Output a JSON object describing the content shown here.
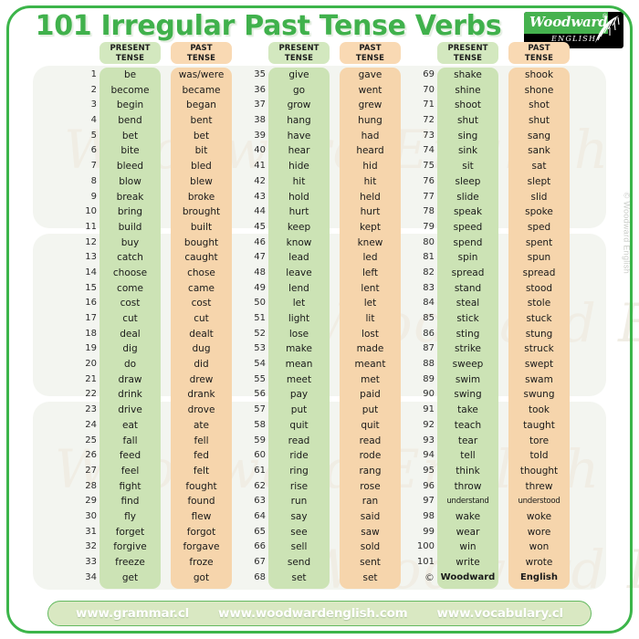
{
  "title": "101 Irregular Past Tense Verbs",
  "logo": {
    "brand": "Woodward",
    "registered": "®",
    "sub": "ENGLISH",
    "leaf_icon": "fern-leaf-icon"
  },
  "side_copyright": "© Woodward English",
  "watermark_text": "Woodward English",
  "colors": {
    "frame_green": "#3cb54a",
    "title_green": "#40b14c",
    "present_cell": "#cce3b5",
    "present_header": "#d3e8bf",
    "past_cell": "#f6d5ac",
    "past_header": "#f9d9b3",
    "urlbar_bg": "#d9e8c2",
    "urlbar_border": "#63b95f"
  },
  "headers": {
    "present_line1": "PRESENT",
    "present_line2": "TENSE",
    "past_line1": "PAST",
    "past_line2": "TENSE"
  },
  "footer_row": {
    "num": "©",
    "present": "Woodward",
    "past": "English"
  },
  "links": [
    "www.grammar.cl",
    "www.woodwardenglish.com",
    "www.vocabulary.cl"
  ],
  "columns": [
    {
      "rows": [
        {
          "n": "1",
          "present": "be",
          "past": "was/were"
        },
        {
          "n": "2",
          "present": "become",
          "past": "became"
        },
        {
          "n": "3",
          "present": "begin",
          "past": "began"
        },
        {
          "n": "4",
          "present": "bend",
          "past": "bent"
        },
        {
          "n": "5",
          "present": "bet",
          "past": "bet"
        },
        {
          "n": "6",
          "present": "bite",
          "past": "bit"
        },
        {
          "n": "7",
          "present": "bleed",
          "past": "bled"
        },
        {
          "n": "8",
          "present": "blow",
          "past": "blew"
        },
        {
          "n": "9",
          "present": "break",
          "past": "broke"
        },
        {
          "n": "10",
          "present": "bring",
          "past": "brought"
        },
        {
          "n": "11",
          "present": "build",
          "past": "built"
        },
        {
          "n": "12",
          "present": "buy",
          "past": "bought"
        },
        {
          "n": "13",
          "present": "catch",
          "past": "caught"
        },
        {
          "n": "14",
          "present": "choose",
          "past": "chose"
        },
        {
          "n": "15",
          "present": "come",
          "past": "came"
        },
        {
          "n": "16",
          "present": "cost",
          "past": "cost"
        },
        {
          "n": "17",
          "present": "cut",
          "past": "cut"
        },
        {
          "n": "18",
          "present": "deal",
          "past": "dealt"
        },
        {
          "n": "19",
          "present": "dig",
          "past": "dug"
        },
        {
          "n": "20",
          "present": "do",
          "past": "did"
        },
        {
          "n": "21",
          "present": "draw",
          "past": "drew"
        },
        {
          "n": "22",
          "present": "drink",
          "past": "drank"
        },
        {
          "n": "23",
          "present": "drive",
          "past": "drove"
        },
        {
          "n": "24",
          "present": "eat",
          "past": "ate"
        },
        {
          "n": "25",
          "present": "fall",
          "past": "fell"
        },
        {
          "n": "26",
          "present": "feed",
          "past": "fed"
        },
        {
          "n": "27",
          "present": "feel",
          "past": "felt"
        },
        {
          "n": "28",
          "present": "fight",
          "past": "fought"
        },
        {
          "n": "29",
          "present": "find",
          "past": "found"
        },
        {
          "n": "30",
          "present": "fly",
          "past": "flew"
        },
        {
          "n": "31",
          "present": "forget",
          "past": "forgot"
        },
        {
          "n": "32",
          "present": "forgive",
          "past": "forgave"
        },
        {
          "n": "33",
          "present": "freeze",
          "past": "froze"
        },
        {
          "n": "34",
          "present": "get",
          "past": "got"
        }
      ]
    },
    {
      "rows": [
        {
          "n": "35",
          "present": "give",
          "past": "gave"
        },
        {
          "n": "36",
          "present": "go",
          "past": "went"
        },
        {
          "n": "37",
          "present": "grow",
          "past": "grew"
        },
        {
          "n": "38",
          "present": "hang",
          "past": "hung"
        },
        {
          "n": "39",
          "present": "have",
          "past": "had"
        },
        {
          "n": "40",
          "present": "hear",
          "past": "heard"
        },
        {
          "n": "41",
          "present": "hide",
          "past": "hid"
        },
        {
          "n": "42",
          "present": "hit",
          "past": "hit"
        },
        {
          "n": "43",
          "present": "hold",
          "past": "held"
        },
        {
          "n": "44",
          "present": "hurt",
          "past": "hurt"
        },
        {
          "n": "45",
          "present": "keep",
          "past": "kept"
        },
        {
          "n": "46",
          "present": "know",
          "past": "knew"
        },
        {
          "n": "47",
          "present": "lead",
          "past": "led"
        },
        {
          "n": "48",
          "present": "leave",
          "past": "left"
        },
        {
          "n": "49",
          "present": "lend",
          "past": "lent"
        },
        {
          "n": "50",
          "present": "let",
          "past": "let"
        },
        {
          "n": "51",
          "present": "light",
          "past": "lit"
        },
        {
          "n": "52",
          "present": "lose",
          "past": "lost"
        },
        {
          "n": "53",
          "present": "make",
          "past": "made"
        },
        {
          "n": "54",
          "present": "mean",
          "past": "meant"
        },
        {
          "n": "55",
          "present": "meet",
          "past": "met"
        },
        {
          "n": "56",
          "present": "pay",
          "past": "paid"
        },
        {
          "n": "57",
          "present": "put",
          "past": "put"
        },
        {
          "n": "58",
          "present": "quit",
          "past": "quit"
        },
        {
          "n": "59",
          "present": "read",
          "past": "read"
        },
        {
          "n": "60",
          "present": "ride",
          "past": "rode"
        },
        {
          "n": "61",
          "present": "ring",
          "past": "rang"
        },
        {
          "n": "62",
          "present": "rise",
          "past": "rose"
        },
        {
          "n": "63",
          "present": "run",
          "past": "ran"
        },
        {
          "n": "64",
          "present": "say",
          "past": "said"
        },
        {
          "n": "65",
          "present": "see",
          "past": "saw"
        },
        {
          "n": "66",
          "present": "sell",
          "past": "sold"
        },
        {
          "n": "67",
          "present": "send",
          "past": "sent"
        },
        {
          "n": "68",
          "present": "set",
          "past": "set"
        }
      ]
    },
    {
      "rows": [
        {
          "n": "69",
          "present": "shake",
          "past": "shook"
        },
        {
          "n": "70",
          "present": "shine",
          "past": "shone"
        },
        {
          "n": "71",
          "present": "shoot",
          "past": "shot"
        },
        {
          "n": "72",
          "present": "shut",
          "past": "shut"
        },
        {
          "n": "73",
          "present": "sing",
          "past": "sang"
        },
        {
          "n": "74",
          "present": "sink",
          "past": "sank"
        },
        {
          "n": "75",
          "present": "sit",
          "past": "sat"
        },
        {
          "n": "76",
          "present": "sleep",
          "past": "slept"
        },
        {
          "n": "77",
          "present": "slide",
          "past": "slid"
        },
        {
          "n": "78",
          "present": "speak",
          "past": "spoke"
        },
        {
          "n": "79",
          "present": "speed",
          "past": "sped"
        },
        {
          "n": "80",
          "present": "spend",
          "past": "spent"
        },
        {
          "n": "81",
          "present": "spin",
          "past": "spun"
        },
        {
          "n": "82",
          "present": "spread",
          "past": "spread"
        },
        {
          "n": "83",
          "present": "stand",
          "past": "stood"
        },
        {
          "n": "84",
          "present": "steal",
          "past": "stole"
        },
        {
          "n": "85",
          "present": "stick",
          "past": "stuck"
        },
        {
          "n": "86",
          "present": "sting",
          "past": "stung"
        },
        {
          "n": "87",
          "present": "strike",
          "past": "struck"
        },
        {
          "n": "88",
          "present": "sweep",
          "past": "swept"
        },
        {
          "n": "89",
          "present": "swim",
          "past": "swam"
        },
        {
          "n": "90",
          "present": "swing",
          "past": "swung"
        },
        {
          "n": "91",
          "present": "take",
          "past": "took"
        },
        {
          "n": "92",
          "present": "teach",
          "past": "taught"
        },
        {
          "n": "93",
          "present": "tear",
          "past": "tore"
        },
        {
          "n": "94",
          "present": "tell",
          "past": "told"
        },
        {
          "n": "95",
          "present": "think",
          "past": "thought"
        },
        {
          "n": "96",
          "present": "throw",
          "past": "threw"
        },
        {
          "n": "97",
          "present": "understand",
          "past": "understood"
        },
        {
          "n": "98",
          "present": "wake",
          "past": "woke"
        },
        {
          "n": "99",
          "present": "wear",
          "past": "wore"
        },
        {
          "n": "100",
          "present": "win",
          "past": "won"
        },
        {
          "n": "101",
          "present": "write",
          "past": "wrote"
        }
      ]
    }
  ]
}
